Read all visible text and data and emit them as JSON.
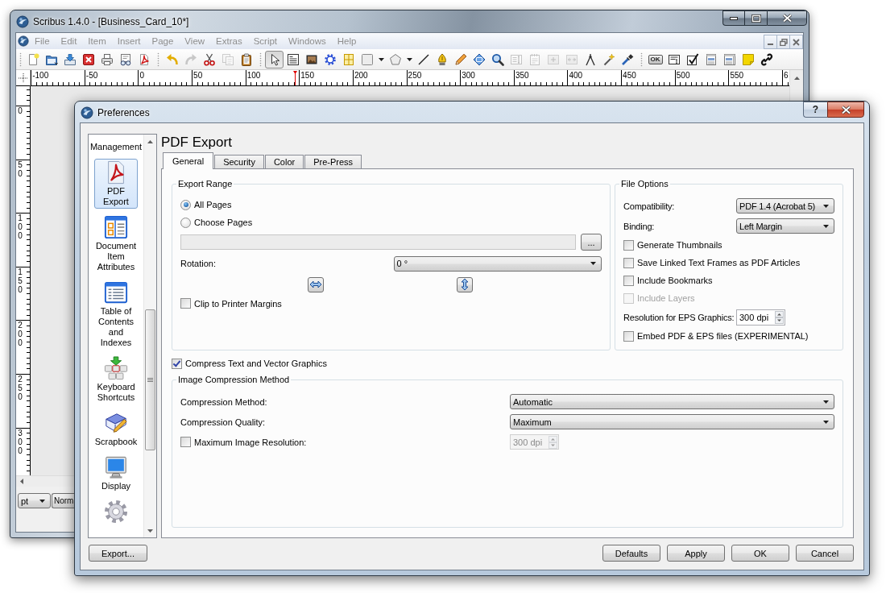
{
  "main_window": {
    "title": "Scribus 1.4.0 - [Business_Card_10*]",
    "menu": [
      {
        "label": "File",
        "disabled": true
      },
      {
        "label": "Edit",
        "disabled": true
      },
      {
        "label": "Item",
        "disabled": true
      },
      {
        "label": "Insert",
        "disabled": true
      },
      {
        "label": "Page",
        "disabled": true
      },
      {
        "label": "View",
        "disabled": true
      },
      {
        "label": "Extras",
        "disabled": true
      },
      {
        "label": "Script",
        "disabled": true
      },
      {
        "label": "Windows",
        "disabled": true
      },
      {
        "label": "Help",
        "disabled": true
      }
    ],
    "toolbar": [
      [
        {
          "selected": false,
          "disabled": false
        },
        {
          "selected": false,
          "disabled": false
        },
        {
          "selected": false,
          "disabled": false
        },
        {
          "selected": false,
          "disabled": false
        },
        {
          "selected": false,
          "disabled": false
        },
        {
          "selected": false,
          "disabled": false
        },
        {
          "selected": false,
          "disabled": false
        }
      ],
      [
        {
          "selected": false,
          "disabled": false
        },
        {
          "selected": false,
          "disabled": true
        },
        {
          "selected": false,
          "disabled": false
        },
        {
          "selected": false,
          "disabled": true
        },
        {
          "selected": false,
          "disabled": false
        }
      ],
      [
        {
          "selected": true,
          "disabled": false
        },
        {
          "selected": false,
          "disabled": false
        },
        {
          "selected": false,
          "disabled": false
        },
        {
          "selected": false,
          "disabled": false
        },
        {
          "selected": false,
          "disabled": false
        },
        {
          "selected": false,
          "disabled": false
        },
        {
          "selected": false,
          "disabled": false
        },
        {
          "selected": false,
          "disabled": false
        },
        {
          "selected": false,
          "disabled": false
        },
        {
          "selected": false,
          "disabled": false
        },
        {
          "selected": false,
          "disabled": false
        },
        {
          "selected": false,
          "disabled": false
        },
        {
          "selected": false,
          "disabled": false
        },
        {
          "selected": false,
          "disabled": false
        },
        {
          "selected": false,
          "disabled": true
        },
        {
          "selected": false,
          "disabled": true
        },
        {
          "selected": false,
          "disabled": true
        },
        {
          "selected": false,
          "disabled": true
        },
        {
          "selected": false,
          "disabled": false
        },
        {
          "selected": false,
          "disabled": false
        },
        {
          "selected": false,
          "disabled": false
        }
      ],
      [
        {
          "label": "OK",
          "selected": false,
          "disabled": false
        },
        {
          "selected": false,
          "disabled": false
        },
        {
          "selected": false,
          "disabled": false
        },
        {
          "selected": false,
          "disabled": false
        },
        {
          "selected": false,
          "disabled": false
        },
        {
          "selected": false,
          "disabled": false
        },
        {
          "selected": false,
          "disabled": false
        }
      ]
    ],
    "rulers": {
      "horizontal": [
        "-100",
        "-50",
        "0",
        "50",
        "100",
        "150",
        "200",
        "250",
        "300",
        "350",
        "400",
        "450",
        "500",
        "550",
        "6"
      ],
      "vertical": [
        "0",
        "50",
        "100",
        "150",
        "200",
        "250",
        "300"
      ]
    },
    "status_bar": {
      "unit": "pt",
      "mode": "Norm"
    }
  },
  "dialog": {
    "title": "Preferences",
    "help_button": "?",
    "sidebar": [
      {
        "label": "Management",
        "selected": false
      },
      {
        "label": "PDF Export",
        "selected": true
      },
      {
        "label": "Document Item Attributes",
        "selected": false
      },
      {
        "label": "Table of Contents and Indexes",
        "selected": false
      },
      {
        "label": "Keyboard Shortcuts",
        "selected": false
      },
      {
        "label": "Scrapbook",
        "selected": false
      },
      {
        "label": "Display",
        "selected": false
      },
      {
        "selected": false
      }
    ],
    "heading": "PDF Export",
    "tabs": [
      {
        "label": "General",
        "selected": true
      },
      {
        "label": "Security",
        "selected": false
      },
      {
        "label": "Color",
        "selected": false
      },
      {
        "label": "Pre-Press",
        "selected": false
      }
    ],
    "export_range": {
      "title": "Export Range",
      "options": [
        {
          "label": "All Pages",
          "selected": true
        },
        {
          "label": "Choose Pages",
          "selected": false
        }
      ],
      "pages_field": {
        "disabled": true
      },
      "pages_button": "...",
      "rotation": {
        "label": "Rotation:",
        "value": "0 °"
      },
      "clip": {
        "label": "Clip to Printer Margins",
        "checked": false
      }
    },
    "file_options": {
      "title": "File Options",
      "rows": [
        {
          "kind": "combo",
          "label": "Compatibility:",
          "value": "PDF 1.4 (Acrobat 5)",
          "disabled": false
        },
        {
          "kind": "combo",
          "label": "Binding:",
          "value": "Left Margin",
          "disabled": false
        },
        {
          "kind": "check",
          "label": "Generate Thumbnails",
          "checked": false,
          "disabled": false
        },
        {
          "kind": "check",
          "label": "Save Linked Text Frames as PDF Articles",
          "checked": false,
          "disabled": false
        },
        {
          "kind": "check",
          "label": "Include Bookmarks",
          "checked": false,
          "disabled": false
        },
        {
          "kind": "check",
          "label": "Include Layers",
          "checked": false,
          "disabled": true
        },
        {
          "kind": "spin",
          "label": "Resolution for EPS Graphics:",
          "value": "300 dpi",
          "disabled": false
        },
        {
          "kind": "check",
          "label": "Embed PDF & EPS files (EXPERIMENTAL)",
          "checked": false,
          "disabled": false
        }
      ]
    },
    "compress_text": {
      "label": "Compress Text and Vector Graphics",
      "checked": true
    },
    "image_compression": {
      "title": "Image Compression Method",
      "rows": [
        {
          "kind": "combo",
          "label": "Compression Method:",
          "value": "Automatic",
          "disabled": false
        },
        {
          "kind": "combo",
          "label": "Compression Quality:",
          "value": "Maximum",
          "disabled": false
        },
        {
          "kind": "check_spin",
          "label": "Maximum Image Resolution:",
          "checked": false,
          "value": "300 dpi",
          "disabled": false
        }
      ]
    },
    "export_button": "Export...",
    "buttons": [
      "Defaults",
      "Apply",
      "OK",
      "Cancel"
    ]
  }
}
